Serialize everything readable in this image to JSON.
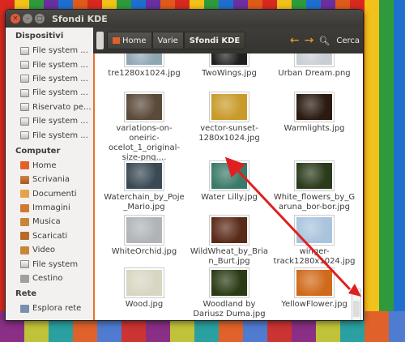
{
  "window": {
    "title": "Sfondi KDE"
  },
  "sidebar": {
    "sections": [
      {
        "title": "Dispositivi",
        "items": [
          {
            "label": "File system ...",
            "icon": "drive-icon"
          },
          {
            "label": "File system ...",
            "icon": "drive-icon"
          },
          {
            "label": "File system ...",
            "icon": "drive-icon"
          },
          {
            "label": "File system ...",
            "icon": "drive-icon"
          },
          {
            "label": "Riservato pe...",
            "icon": "drive-icon"
          },
          {
            "label": "File system ...",
            "icon": "drive-icon"
          },
          {
            "label": "File system ...",
            "icon": "drive-icon"
          }
        ]
      },
      {
        "title": "Computer",
        "items": [
          {
            "label": "Home",
            "icon": "home-icon"
          },
          {
            "label": "Scrivania",
            "icon": "desktop-icon"
          },
          {
            "label": "Documenti",
            "icon": "documents-icon"
          },
          {
            "label": "Immagini",
            "icon": "pictures-icon"
          },
          {
            "label": "Musica",
            "icon": "music-icon"
          },
          {
            "label": "Scaricati",
            "icon": "downloads-icon"
          },
          {
            "label": "Video",
            "icon": "videos-icon"
          },
          {
            "label": "File system",
            "icon": "drive-icon"
          },
          {
            "label": "Cestino",
            "icon": "trash-icon"
          }
        ]
      },
      {
        "title": "Rete",
        "items": [
          {
            "label": "Esplora rete",
            "icon": "network-icon"
          }
        ]
      }
    ]
  },
  "toolbar": {
    "breadcrumbs": [
      "Home",
      "Varie",
      "Sfondi KDE"
    ],
    "search_label": "Cerca"
  },
  "files": [
    {
      "name": "tre1280x1024.jpg",
      "thumb": "#8fa6b3"
    },
    {
      "name": "TwoWings.jpg",
      "thumb": "#1f1f1f"
    },
    {
      "name": "Urban Dream.png",
      "thumb": "#c8ced4"
    },
    {
      "name": "variations-on-oneiric-ocelot_1_original-size-png....",
      "thumb": "#5a4a3a"
    },
    {
      "name": "vector-sunset-1280x1024.jpg",
      "thumb": "#c89a2a"
    },
    {
      "name": "Warmlights.jpg",
      "thumb": "#2a1a10"
    },
    {
      "name": "Waterchain_by_Poje_Mario.jpg",
      "thumb": "#3a4a55"
    },
    {
      "name": "Water Lilly.jpg",
      "thumb": "#3b7a6a"
    },
    {
      "name": "White_flowers_by_Garuna_bor-bor.jpg",
      "thumb": "#2a3a1a"
    },
    {
      "name": "WhiteOrchid.jpg",
      "thumb": "#b0b4b8"
    },
    {
      "name": "WildWheat_by_Brian_Burt.jpg",
      "thumb": "#5a2a18"
    },
    {
      "name": "winger-track1280x1024.jpg",
      "thumb": "#a9c4dd"
    },
    {
      "name": "Wood.jpg",
      "thumb": "#d8d6c2"
    },
    {
      "name": "Woodland by Dariusz Duma.jpg",
      "thumb": "#2a3a14"
    },
    {
      "name": "YellowFlower.jpg",
      "thumb": "#d06a1a"
    }
  ],
  "colors": {
    "accent": "#e5732a",
    "annotation": "#e02020"
  }
}
